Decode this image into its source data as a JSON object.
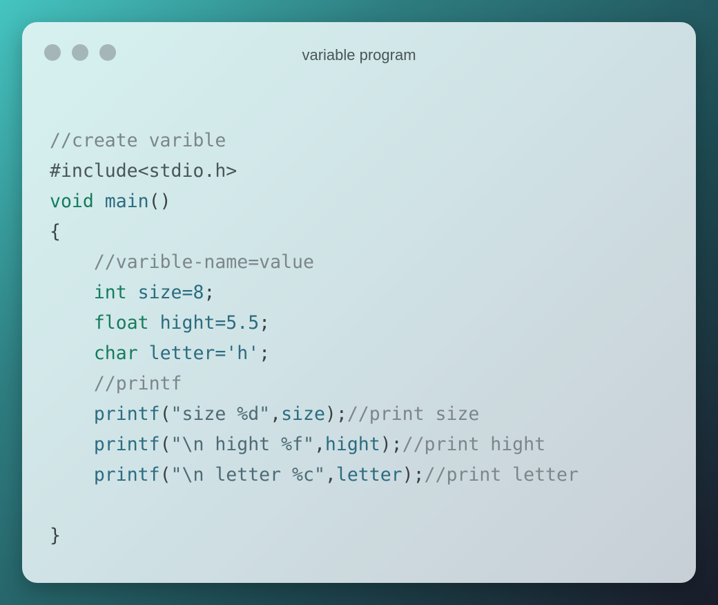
{
  "window": {
    "title": "variable program",
    "colors": {
      "keyword": "#167c5c",
      "identifier": "#2c6c80",
      "comment": "#7c868a",
      "punctuation": "#3a4246"
    }
  },
  "code": {
    "lines": [
      [
        {
          "t": "//create varible",
          "c": "comment"
        }
      ],
      [
        {
          "t": "#include<stdio.h>",
          "c": "pre"
        }
      ],
      [
        {
          "t": "void",
          "c": "kw"
        },
        {
          "t": " ",
          "c": "punct"
        },
        {
          "t": "main",
          "c": "ident"
        },
        {
          "t": "()",
          "c": "punct"
        }
      ],
      [
        {
          "t": "{",
          "c": "punct"
        }
      ],
      [
        {
          "t": "    ",
          "c": "punct"
        },
        {
          "t": "//varible-name=value",
          "c": "comment"
        }
      ],
      [
        {
          "t": "    ",
          "c": "punct"
        },
        {
          "t": "int",
          "c": "kw"
        },
        {
          "t": " ",
          "c": "punct"
        },
        {
          "t": "size=8",
          "c": "ident"
        },
        {
          "t": ";",
          "c": "punct"
        }
      ],
      [
        {
          "t": "    ",
          "c": "punct"
        },
        {
          "t": "float",
          "c": "kw"
        },
        {
          "t": " ",
          "c": "punct"
        },
        {
          "t": "hight=5.5",
          "c": "ident"
        },
        {
          "t": ";",
          "c": "punct"
        }
      ],
      [
        {
          "t": "    ",
          "c": "punct"
        },
        {
          "t": "char",
          "c": "kw"
        },
        {
          "t": " ",
          "c": "punct"
        },
        {
          "t": "letter='h'",
          "c": "ident"
        },
        {
          "t": ";",
          "c": "punct"
        }
      ],
      [
        {
          "t": "    ",
          "c": "punct"
        },
        {
          "t": "//printf",
          "c": "comment"
        }
      ],
      [
        {
          "t": "    ",
          "c": "punct"
        },
        {
          "t": "printf",
          "c": "ident"
        },
        {
          "t": "(",
          "c": "punct"
        },
        {
          "t": "\"size %d\"",
          "c": "str"
        },
        {
          "t": ",",
          "c": "punct"
        },
        {
          "t": "size",
          "c": "ident"
        },
        {
          "t": ");",
          "c": "punct"
        },
        {
          "t": "//print size",
          "c": "comment"
        }
      ],
      [
        {
          "t": "    ",
          "c": "punct"
        },
        {
          "t": "printf",
          "c": "ident"
        },
        {
          "t": "(",
          "c": "punct"
        },
        {
          "t": "\"\\n hight %f\"",
          "c": "str"
        },
        {
          "t": ",",
          "c": "punct"
        },
        {
          "t": "hight",
          "c": "ident"
        },
        {
          "t": ");",
          "c": "punct"
        },
        {
          "t": "//print hight",
          "c": "comment"
        }
      ],
      [
        {
          "t": "    ",
          "c": "punct"
        },
        {
          "t": "printf",
          "c": "ident"
        },
        {
          "t": "(",
          "c": "punct"
        },
        {
          "t": "\"\\n letter %c\"",
          "c": "str"
        },
        {
          "t": ",",
          "c": "punct"
        },
        {
          "t": "letter",
          "c": "ident"
        },
        {
          "t": ");",
          "c": "punct"
        },
        {
          "t": "//print letter",
          "c": "comment"
        }
      ],
      [
        {
          "t": "",
          "c": "punct"
        }
      ],
      [
        {
          "t": "}",
          "c": "punct"
        }
      ]
    ]
  }
}
